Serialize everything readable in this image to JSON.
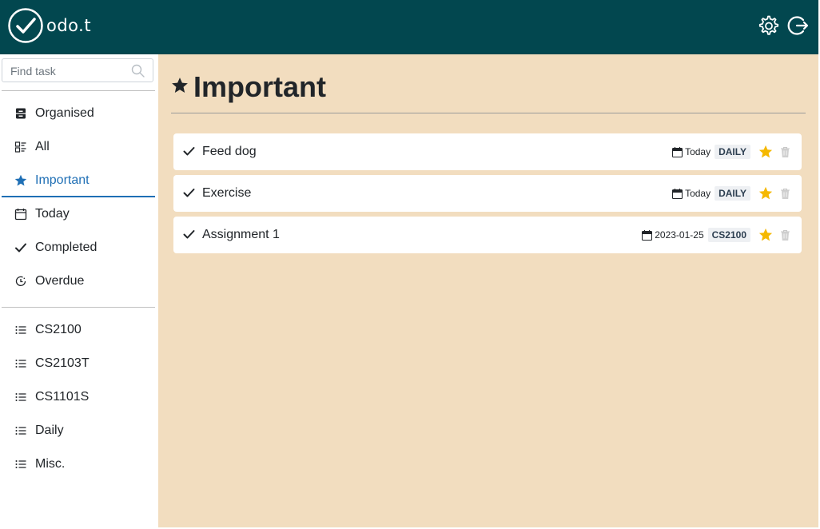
{
  "app": {
    "logo_text": "odo.t",
    "colors": {
      "header": "#02474f",
      "main_bg": "#f2ddbf",
      "accent": "#1f6fb5",
      "star": "#f5b800"
    }
  },
  "header": {
    "settings_icon": "gear-icon",
    "logout_icon": "logout-icon"
  },
  "search": {
    "placeholder": "Find task",
    "value": ""
  },
  "nav": [
    {
      "label": "Organised",
      "icon": "archive-icon"
    },
    {
      "label": "All",
      "icon": "list-all-icon"
    },
    {
      "label": "Important",
      "icon": "star-icon",
      "active": true
    },
    {
      "label": "Today",
      "icon": "calendar-icon"
    },
    {
      "label": "Completed",
      "icon": "check-icon"
    },
    {
      "label": "Overdue",
      "icon": "clock-icon"
    }
  ],
  "lists": [
    {
      "label": "CS2100",
      "icon": "list-icon"
    },
    {
      "label": "CS2103T",
      "icon": "list-icon"
    },
    {
      "label": "CS1101S",
      "icon": "list-icon"
    },
    {
      "label": "Daily",
      "icon": "list-icon"
    },
    {
      "label": "Misc.",
      "icon": "list-icon"
    }
  ],
  "page": {
    "title": "Important"
  },
  "tasks": [
    {
      "name": "Feed dog",
      "date": "Today",
      "tag": "DAILY",
      "important": true
    },
    {
      "name": "Exercise",
      "date": "Today",
      "tag": "DAILY",
      "important": true
    },
    {
      "name": "Assignment 1",
      "date": "2023-01-25",
      "tag": "CS2100",
      "important": true
    }
  ]
}
